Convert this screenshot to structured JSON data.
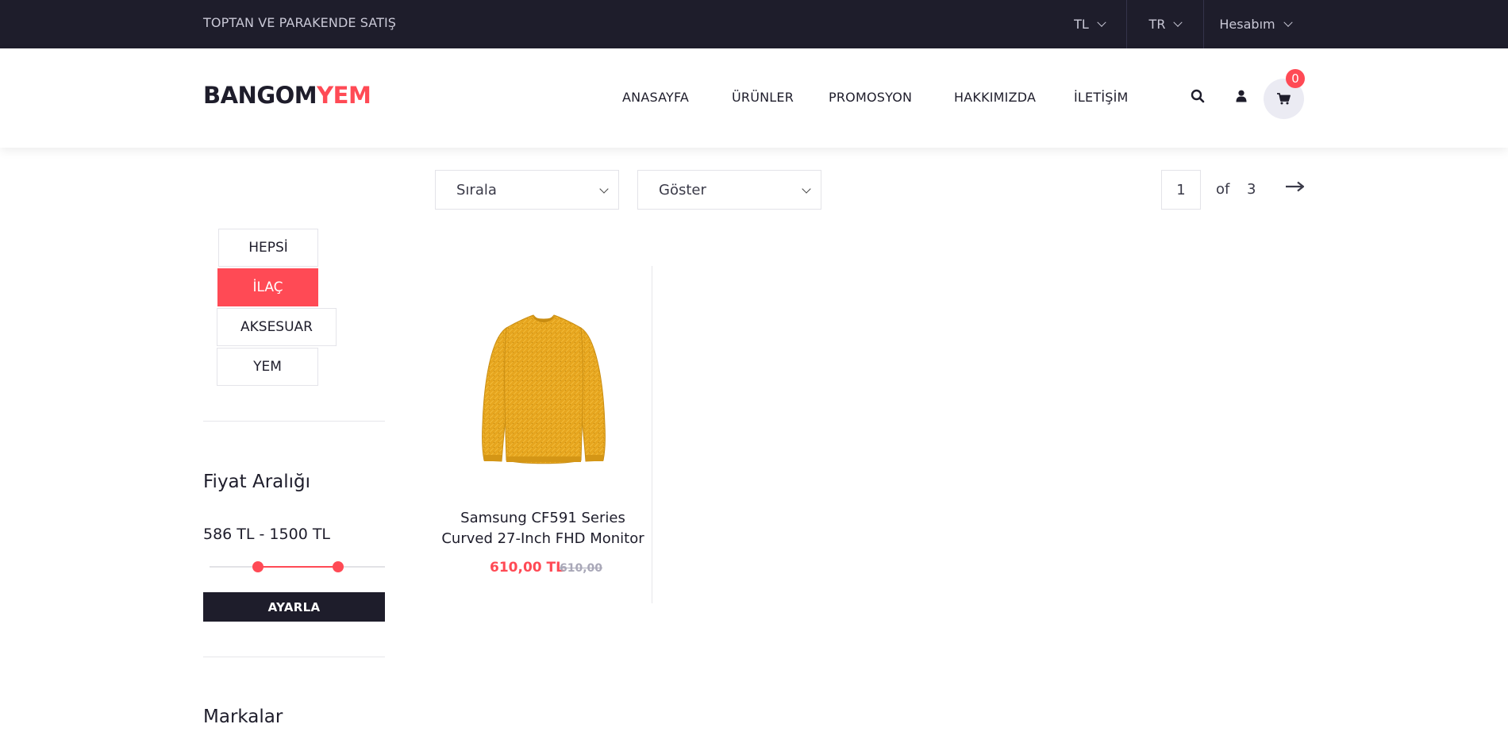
{
  "topbar": {
    "tagline": "TOPTAN VE PARAKENDE SATIŞ",
    "currency": "TL",
    "language": "TR",
    "account": "Hesabım"
  },
  "header": {
    "logo_part1": "BANGOM",
    "logo_part2": "YEM",
    "nav": [
      "ANASAYFA",
      "ÜRÜNLER",
      "PROMOSYON",
      "HAKKIMIZDA",
      "İLETİŞİM"
    ],
    "cart_count": "0"
  },
  "toolbar": {
    "sort_label": "Sırala",
    "show_label": "Göster",
    "current_page": "1",
    "of_label": "of",
    "total_pages": "3"
  },
  "sidebar": {
    "categories": [
      "HEPSİ",
      "İLAÇ",
      "AKSESUAR",
      "YEM"
    ],
    "active_category": "İLAÇ",
    "price_title": "Fiyat Aralığı",
    "price_range": "586 TL - 1500 TL",
    "apply_label": "AYARLA",
    "brands_title": "Markalar"
  },
  "product": {
    "name": "Samsung CF591 Series Curved 27-Inch FHD Monitor",
    "price": "610,00 TL",
    "old_price": "610,00"
  },
  "colors": {
    "accent": "#ff4a55",
    "dark": "#1e1d2b",
    "sweater": "#e6a51e"
  }
}
